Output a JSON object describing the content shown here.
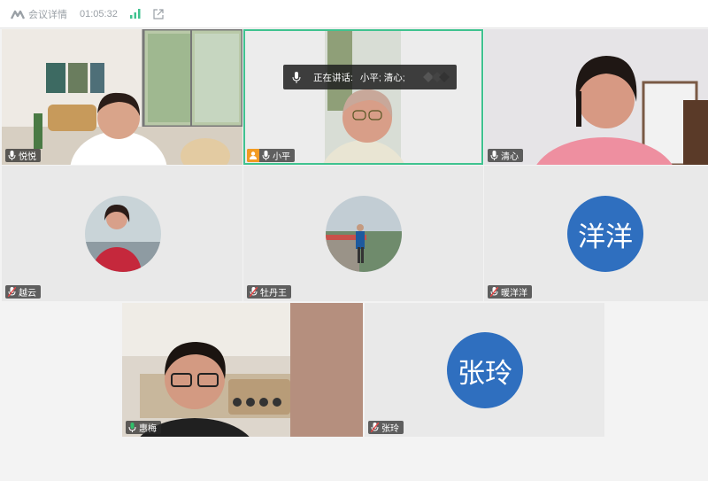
{
  "header": {
    "meeting_detail": "会议详情",
    "timer": "01:05:32"
  },
  "speaking_banner": {
    "label": "正在讲话:",
    "speakers": "小平; 清心;"
  },
  "participants": [
    {
      "name": "悦悦",
      "type": "video",
      "status": "mic-on"
    },
    {
      "name": "小平",
      "type": "video",
      "status": "mic-on",
      "speaking": true
    },
    {
      "name": "清心",
      "type": "video",
      "status": "mic-on"
    },
    {
      "name": "越云",
      "type": "photo",
      "status": "mic-muted"
    },
    {
      "name": "牡丹王",
      "type": "photo",
      "status": "mic-muted"
    },
    {
      "name": "暖洋洋",
      "type": "text-avatar",
      "avatar_text": "洋洋",
      "status": "mic-muted"
    },
    {
      "name": "惠梅",
      "type": "video",
      "status": "mic-muted"
    },
    {
      "name": "张玲",
      "type": "text-avatar",
      "avatar_text": "张玲",
      "status": "mic-muted"
    }
  ],
  "colors": {
    "active_border": "#3fc28f",
    "avatar_blue": "#2f6fbf",
    "camera_badge": "#f29b22"
  }
}
